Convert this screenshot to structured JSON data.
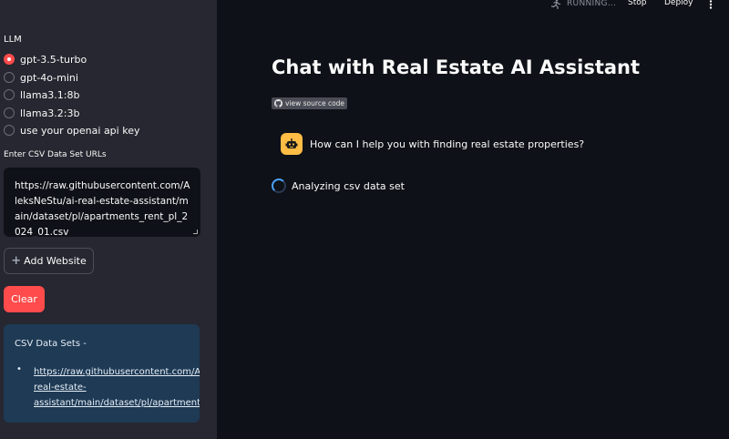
{
  "toolbar": {
    "running_label": "RUNNING...",
    "stop_label": "Stop",
    "deploy_label": "Deploy",
    "menu_icon": "kebab-menu-icon"
  },
  "sidebar": {
    "llm_label": "LLM",
    "llm_options": [
      {
        "label": "gpt-3.5-turbo",
        "checked": true
      },
      {
        "label": "gpt-4o-mini",
        "checked": false
      },
      {
        "label": "llama3.1:8b",
        "checked": false
      },
      {
        "label": "llama3.2:3b",
        "checked": false
      },
      {
        "label": "use your openai api key",
        "checked": false
      }
    ],
    "csv_label": "Enter CSV Data Set URLs",
    "csv_value": "https://raw.githubusercontent.com/AleksNeStu/ai-real-estate-assistant/main/dataset/pl/apartments_rent_pl_2024_01.csv",
    "add_button_label": "Add Website",
    "clear_button_label": "Clear",
    "info": {
      "title": "CSV Data Sets -",
      "bullet": "•",
      "link_lines": [
        "https://raw.githubusercontent.com/Aleks",
        "real-estate-",
        "assistant/main/dataset/pl/apartments_r"
      ]
    }
  },
  "main": {
    "title": "Chat with Real Estate AI Assistant",
    "source_badge": "view source code",
    "assistant_message": "How can I help you with finding real estate properties?",
    "status_text": "Analyzing csv data set"
  },
  "colors": {
    "accent": "#ff4b4b",
    "avatar": "#ffbd45",
    "info_bg": "#1e3a55",
    "spinner": "#4aa3ff"
  }
}
